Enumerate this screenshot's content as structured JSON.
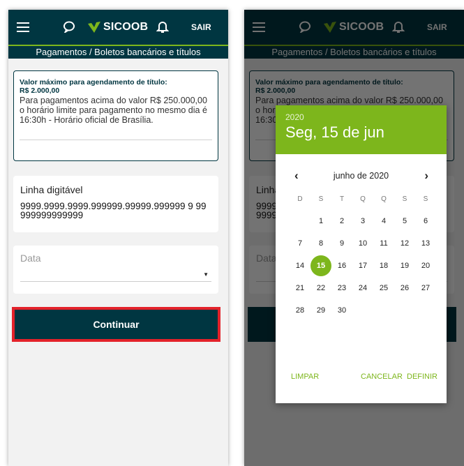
{
  "app": {
    "brand": "SICOOB",
    "logout_label": "SAIR",
    "breadcrumb": "Pagamentos / Boletos bancários e títulos"
  },
  "info": {
    "title": "Valor máximo para agendamento de título:",
    "value": "R$ 2.000,00",
    "text": "Para pagamentos acima do valor R$ 250.000,00 o horário limite para pagamento no mesmo dia é 16:30h - Horário oficial de Brasília."
  },
  "linha": {
    "label": "Linha digitável",
    "value": "9999.9999.9999.999999.99999.999999 9 99999999999999"
  },
  "data_field": {
    "label": "Data"
  },
  "continue_label": "Continuar",
  "background_fragments": {
    "left_pa": "Pa",
    "left_ho": "ho",
    "left_16": "16",
    "right_o": "o",
    "linha_l": "L",
    "linha_3": "3",
    "linha_5": "5",
    "linha_02": "02",
    "data_d": "Da"
  },
  "datepicker": {
    "year": "2020",
    "selected_date": "Seg, 15 de jun",
    "month_title": "junho de 2020",
    "weekdays": [
      "D",
      "S",
      "T",
      "Q",
      "Q",
      "S",
      "S"
    ],
    "weeks": [
      [
        "",
        "1",
        "2",
        "3",
        "4",
        "5",
        "6"
      ],
      [
        "7",
        "8",
        "9",
        "10",
        "11",
        "12",
        "13"
      ],
      [
        "14",
        "15",
        "16",
        "17",
        "18",
        "19",
        "20"
      ],
      [
        "21",
        "22",
        "23",
        "24",
        "25",
        "26",
        "27"
      ],
      [
        "28",
        "29",
        "30",
        "",
        "",
        "",
        ""
      ]
    ],
    "selected_day": "15",
    "clear_label": "LIMPAR",
    "cancel_label": "CANCELAR",
    "set_label": "DEFINIR"
  },
  "colors": {
    "primary": "#003641",
    "accent": "#7db61c",
    "highlight": "#e3222a"
  },
  "icons": [
    "menu-icon",
    "chat-icon",
    "sicoob-logo-icon",
    "bell-icon",
    "dropdown-arrow-icon",
    "chevron-left-icon",
    "chevron-right-icon"
  ]
}
